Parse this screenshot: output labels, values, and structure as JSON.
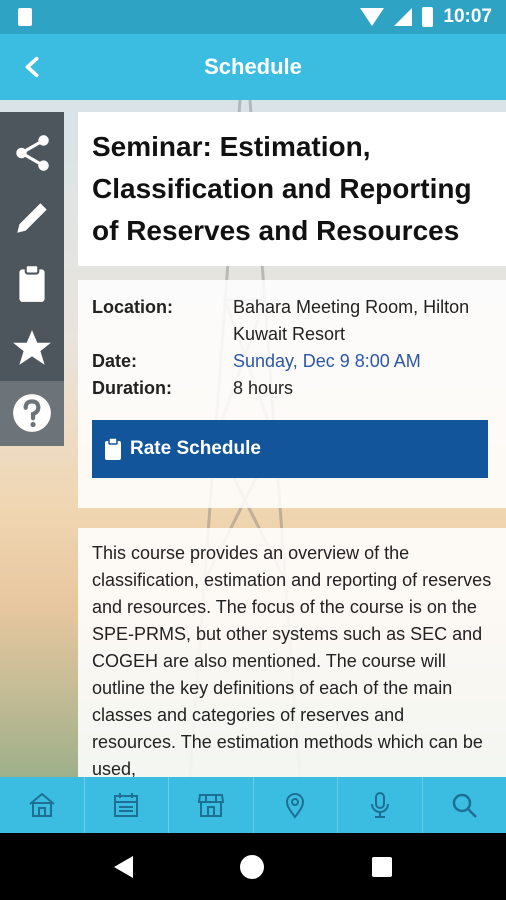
{
  "status_bar": {
    "time": "10:07"
  },
  "app_bar": {
    "title": "Schedule",
    "back_icon": "chevron-left-icon"
  },
  "side_tools": [
    "share-icon",
    "pencil-icon",
    "clipboard-icon",
    "star-icon",
    "help-icon"
  ],
  "session": {
    "title": "Seminar: Estimation, Classification and Reporting of Reserves and Resources",
    "location_label": "Location:",
    "location_value": "Bahara Meeting Room, Hilton Kuwait Resort",
    "date_label": "Date:",
    "date_value": "Sunday, Dec 9 8:00 AM",
    "duration_label": "Duration:",
    "duration_value": "8 hours",
    "rate_button": "Rate Schedule",
    "description": "This course provides an overview of the classification, estimation and reporting of reserves and resources. The focus of the course is on the SPE-PRMS, but other systems such as SEC and COGEH are also mentioned. The course will outline the key definitions of each of the main classes and categories of reserves and resources. The estimation methods which can be used,"
  },
  "bottom_nav": [
    "home-icon",
    "calendar-icon",
    "store-icon",
    "map-pin-icon",
    "microphone-icon",
    "search-icon"
  ],
  "colors": {
    "accent": "#3bbde1",
    "status": "#2fa3c3",
    "button": "#12559a",
    "link": "#2b58a6",
    "tools": "#4d565c"
  }
}
